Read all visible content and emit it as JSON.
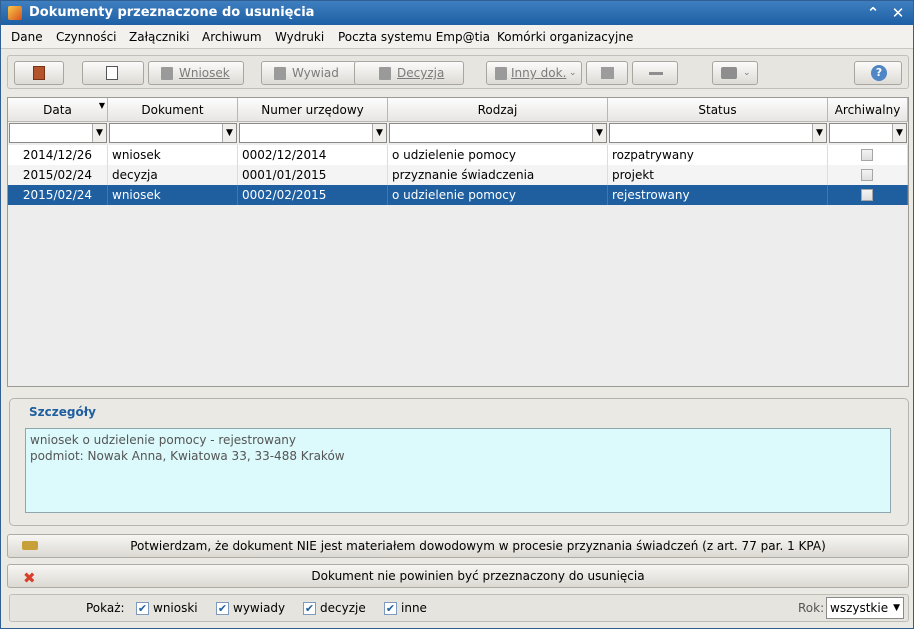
{
  "window": {
    "title": "Dokumenty przeznaczone do usunięcia"
  },
  "menu": [
    "Dane",
    "Czynności",
    "Załączniki",
    "Archiwum",
    "Wydruki",
    "Poczta systemu Emp@tia",
    "Komórki organizacyjne"
  ],
  "toolbar": {
    "wniosek": "Wniosek",
    "wywiad": "Wywiad",
    "decyzja": "Decyzja",
    "inny": "Inny dok.",
    "help": "?"
  },
  "grid": {
    "columns": [
      "Data",
      "Dokument",
      "Numer urzędowy",
      "Rodzaj",
      "Status",
      "Archiwalny"
    ],
    "rows": [
      [
        "2014/12/26",
        "wniosek",
        "0002/12/2014",
        "o udzielenie pomocy",
        "rozpatrywany"
      ],
      [
        "2015/02/24",
        "decyzja",
        "0001/01/2015",
        "przyznanie świadczenia",
        "projekt"
      ],
      [
        "2015/02/24",
        "wniosek",
        "0002/02/2015",
        "o udzielenie pomocy",
        "rejestrowany"
      ]
    ]
  },
  "details": {
    "legend": "Szczegóły",
    "line1": "wniosek o udzielenie pomocy - rejestrowany",
    "line2": "podmiot: Nowak Anna, Kwiatowa 33, 33-488 Kraków"
  },
  "actions": {
    "confirm": "Potwierdzam, że dokument NIE jest materiałem dowodowym w procesie przyznania świadczeń  (z art. 77 par. 1 KPA)",
    "reject": "Dokument nie powinien być przeznaczony do usunięcia"
  },
  "footer": {
    "show_label": "Pokaż:",
    "wnioski": "wnioski",
    "wywiady": "wywiady",
    "decyzje": "decyzje",
    "inne": "inne",
    "year_label": "Rok:",
    "year_value": "wszystkie"
  },
  "colors": {
    "selection": "#1f5fa0",
    "title_bar": "#2b6cb0",
    "details_bg": "#dcf9fb"
  }
}
